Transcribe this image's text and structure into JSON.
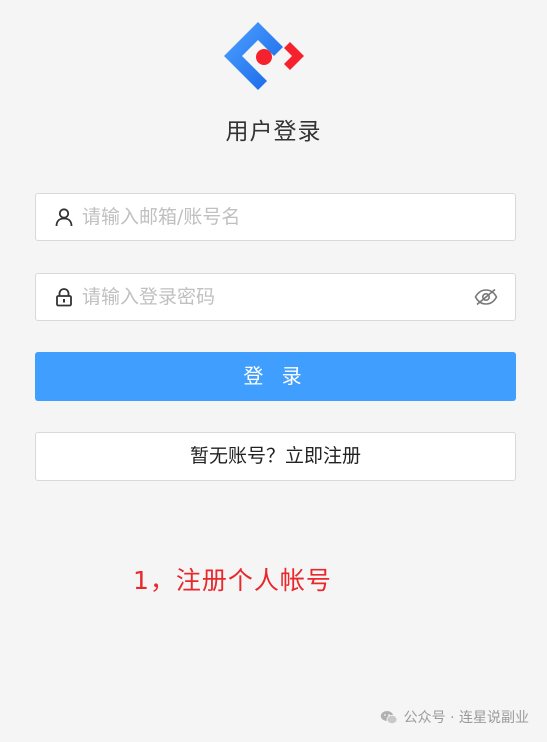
{
  "logo": {
    "icon": "brand-logo-icon",
    "colors": [
      "#1677ff",
      "#f5222d"
    ]
  },
  "title": "用户登录",
  "username": {
    "icon": "user-icon",
    "placeholder": "请输入邮箱/账号名",
    "value": ""
  },
  "password": {
    "icon": "lock-icon",
    "placeholder": "请输入登录密码",
    "value": "",
    "toggle_icon": "eye-hidden-icon"
  },
  "login_button": {
    "label": "登 录",
    "color": "#409eff"
  },
  "register_button": {
    "label": "暂无账号？立即注册"
  },
  "annotation": {
    "text": "1，注册个人帐号",
    "color": "#e8282b"
  },
  "watermark": {
    "icon": "wechat-icon",
    "text": "公众号 · 连星说副业"
  }
}
